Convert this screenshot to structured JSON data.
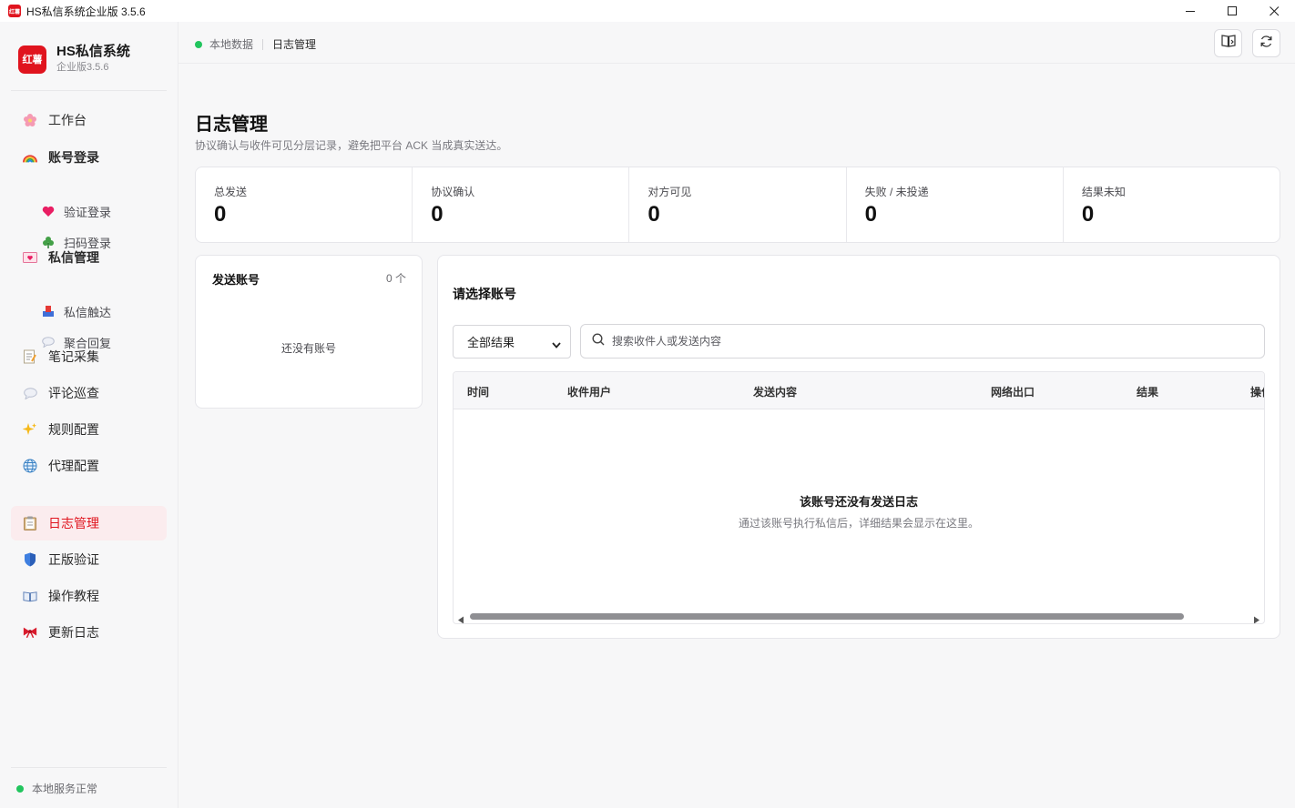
{
  "window": {
    "title": "HS私信系统企业版 3.5.6",
    "icon_text": "红薯",
    "controls": [
      "minimize-icon",
      "maximize-icon",
      "close-icon"
    ]
  },
  "brand": {
    "logo_text": "红薯",
    "name": "HS私信系统",
    "edition": "企业版3.5.6"
  },
  "sidebar": {
    "items": [
      {
        "label": "工作台",
        "icon": "flower-icon"
      },
      {
        "label": "账号登录",
        "icon": "rainbow-icon"
      },
      {
        "label": "验证登录",
        "icon": "heart-icon"
      },
      {
        "label": "扫码登录",
        "icon": "clover-icon"
      },
      {
        "label": "私信管理",
        "icon": "love-letter-icon"
      },
      {
        "label": "私信触达",
        "icon": "inbox-icon"
      },
      {
        "label": "聚合回复",
        "icon": "speech-bubble-icon"
      },
      {
        "label": "笔记采集",
        "icon": "memo-icon"
      },
      {
        "label": "评论巡查",
        "icon": "speech-bubble-icon"
      },
      {
        "label": "规则配置",
        "icon": "sparkles-icon"
      },
      {
        "label": "代理配置",
        "icon": "globe-icon"
      },
      {
        "label": "日志管理",
        "icon": "clipboard-icon"
      },
      {
        "label": "正版验证",
        "icon": "shield-icon"
      },
      {
        "label": "操作教程",
        "icon": "book-icon"
      },
      {
        "label": "更新日志",
        "icon": "ribbon-icon"
      }
    ],
    "active": "日志管理",
    "service_status": "本地服务正常"
  },
  "topbar": {
    "data_source": "本地数据",
    "current_page": "日志管理",
    "buttons": [
      "guide-book-icon",
      "refresh-icon"
    ]
  },
  "page": {
    "title": "日志管理",
    "description": "协议确认与收件可见分层记录，避免把平台 ACK 当成真实送达。"
  },
  "stats": [
    {
      "label": "总发送",
      "value": "0"
    },
    {
      "label": "协议确认",
      "value": "0"
    },
    {
      "label": "对方可见",
      "value": "0"
    },
    {
      "label": "失败 / 未投递",
      "value": "0"
    },
    {
      "label": "结果未知",
      "value": "0"
    }
  ],
  "accounts": {
    "title": "发送账号",
    "count": "0 个",
    "empty_text": "还没有账号"
  },
  "logs": {
    "title": "请选择账号",
    "filter_value": "全部结果",
    "search_placeholder": "搜索收件人或发送内容",
    "columns": [
      "时间",
      "收件用户",
      "发送内容",
      "网络出口",
      "结果",
      "操作"
    ],
    "empty_title": "该账号还没有发送日志",
    "empty_desc": "通过该账号执行私信后，详细结果会显示在这里。"
  },
  "colors": {
    "accent": "#e0141e",
    "active_bg": "#fbecee",
    "status_ok": "#22c55e"
  }
}
